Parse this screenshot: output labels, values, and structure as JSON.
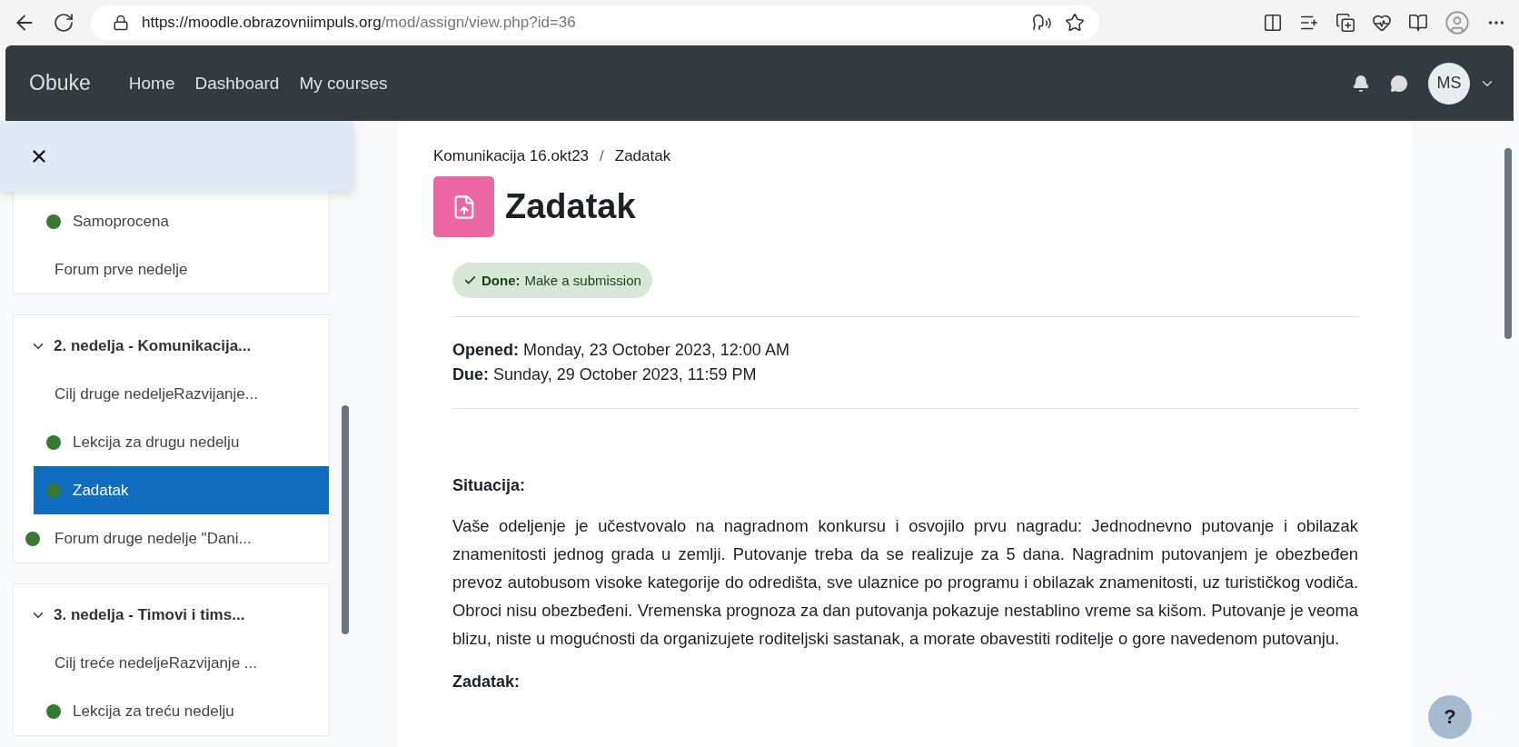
{
  "browser": {
    "url_host": "https://moodle.obrazovniimpuls.org",
    "url_path": "/mod/assign/view.php?id=36"
  },
  "navbar": {
    "brand": "Obuke",
    "links": [
      "Home",
      "Dashboard",
      "My courses"
    ],
    "avatar": "MS"
  },
  "sidebar": {
    "sections": [
      {
        "items": [
          {
            "kind": "activity",
            "label": "Samoprocena",
            "completed": true,
            "selected": false
          },
          {
            "kind": "link",
            "label": "Forum prve nedelje",
            "completed": false,
            "selected": false
          }
        ]
      },
      {
        "title": "2. nedelja - Komunikacija...",
        "expanded": true,
        "items": [
          {
            "kind": "link",
            "label": "Cilj druge nedeljeRazvijanje...",
            "completed": false,
            "selected": false
          },
          {
            "kind": "activity",
            "label": "Lekcija za drugu nedelju",
            "completed": true,
            "selected": false
          },
          {
            "kind": "activity",
            "label": "Zadatak",
            "completed": true,
            "selected": true
          },
          {
            "kind": "link",
            "label": "Forum druge nedelje \"Dani...",
            "completed": true,
            "selected": false
          }
        ]
      },
      {
        "title": "3. nedelja - Timovi i tims...",
        "expanded": true,
        "items": [
          {
            "kind": "link",
            "label": "Cilj treće nedeljeRazvijanje ...",
            "completed": false,
            "selected": false
          },
          {
            "kind": "activity",
            "label": "Lekcija za treću nedelju",
            "completed": true,
            "selected": false
          }
        ]
      }
    ]
  },
  "content": {
    "breadcrumb": [
      "Komunikacija 16.okt23",
      "Zadatak"
    ],
    "breadcrumb_separator": "/",
    "title": "Zadatak",
    "completion": {
      "done": true,
      "label": "Done:",
      "text": "Make a submission"
    },
    "dates": [
      {
        "label": "Opened:",
        "value": "Monday, 23 October 2023, 12:00 AM"
      },
      {
        "label": "Due:",
        "value": "Sunday, 29 October 2023, 11:59 PM"
      }
    ],
    "body": [
      {
        "kind": "heading",
        "text": "Situacija:"
      },
      {
        "kind": "paragraph",
        "text": "Vaše odeljenje je učestvovalo na nagradnom konkursu i osvojilo prvu nagradu: Jednodnevno putovanje i obilazak znamenitosti jednog grada u zemlji. Putovanje treba da se realizuje za 5 dana. Nagradnim putovanjem je obezbeđen prevoz autobusom visoke kategorije do odredišta, sve ulaznice po programu i obilazak znamenitosti, uz turističkog vodiča. Obroci nisu obezbeđeni. Vremenska prognoza za dan putovanja pokazuje nestablino vreme sa kišom. Putovanje je veoma blizu, niste u mogućnosti da organizujete roditeljski sastanak, a morate obavestiti roditelje o gore navedenom putovanju."
      },
      {
        "kind": "heading",
        "text": "Zadatak:"
      }
    ]
  },
  "help": {
    "label": "?"
  }
}
